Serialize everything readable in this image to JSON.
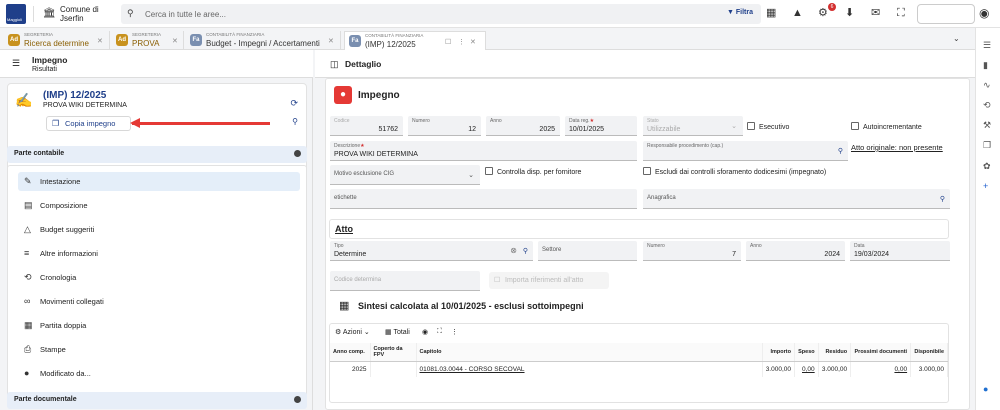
{
  "topbar": {
    "logo_text": "Maggioli",
    "comune_line1": "Comune di",
    "comune_line2": "Jserfin",
    "search_placeholder": "Cerca in tutte le aree...",
    "filtra_label": "Filtra",
    "notification_count": "6"
  },
  "tabs": [
    {
      "small": "SEGRETERIA",
      "label": "Ricerca determine",
      "icon": "Ad",
      "color": "#c8921e"
    },
    {
      "small": "SEGRETERIA",
      "label": "PROVA",
      "icon": "Ad",
      "color": "#c8921e"
    },
    {
      "small": "CONTABILITÀ FINANZIARIA",
      "label": "Budget - Impegni / Accertamenti",
      "icon": "Fa",
      "color": "#7a8fb0"
    },
    {
      "small": "CONTABILITÀ FINANZIARIA",
      "label": "(IMP) 12/2025",
      "icon": "Fa",
      "color": "#7a8fb0"
    }
  ],
  "left": {
    "title": "Impegno",
    "subtitle": "Risultati",
    "card_title": "(IMP) 12/2025",
    "card_desc": "PROVA WIKI DETERMINA",
    "copy_label": "Copia impegno",
    "section1": "Parte contabile",
    "section2": "Parte documentale",
    "menu": [
      "Intestazione",
      "Composizione",
      "Budget suggeriti",
      "Altre informazioni",
      "Cronologia",
      "Movimenti collegati",
      "Partita doppia",
      "Stampe",
      "Modificato da..."
    ]
  },
  "detail": {
    "header": "Dettaglio",
    "impegno_title": "Impegno",
    "codice_label": "Codice",
    "codice": "51762",
    "numero_label": "Numero",
    "numero": "12",
    "anno_label": "Anno",
    "anno": "2025",
    "datareg_label": "Data reg.",
    "datareg": "10/01/2025",
    "stato_label": "Stato",
    "stato": "Utilizzabile",
    "esecutivo": "Esecutivo",
    "autoincrementante": "Autoincrementante",
    "descrizione_label": "Descrizione",
    "descrizione": "PROVA WIKI DETERMINA",
    "responsabile_label": "Responsabile procedimento (cap.)",
    "atto_originale": "Atto originale: non presente",
    "motivo_label": "Motivo esclusione CIG",
    "controlla": "Controlla disp. per fornitore",
    "escludi": "Escludi dai controlli sforamento dodicesimi (impegnato)",
    "etichette_label": "etichette",
    "anagrafica_label": "Anagrafica",
    "atto_title": "Atto",
    "tipo_label": "Tipo",
    "tipo": "Determine",
    "settore_label": "Settore",
    "atto_numero_label": "Numero",
    "atto_numero": "7",
    "atto_anno_label": "Anno",
    "atto_anno": "2024",
    "data_label": "Data",
    "data": "19/03/2024",
    "codice_det_label": "Codice determina",
    "importa": "Importa riferimenti all'atto",
    "sintesi": "Sintesi calcolata al 10/01/2025 - esclusi sottoimpegni",
    "azioni": "Azioni",
    "totali": "Totali"
  },
  "table": {
    "headers": [
      "Anno comp.",
      "Coperto da FPV",
      "Capitolo",
      "Importo",
      "Speso",
      "Residuo",
      "Prossimi documenti",
      "Disponibile"
    ],
    "rows": [
      [
        "2025",
        "",
        "01081.03.0044 - CORSO SECOVAL",
        "3.000,00",
        "0,00",
        "3.000,00",
        "0,00",
        "3.000,00"
      ]
    ]
  }
}
